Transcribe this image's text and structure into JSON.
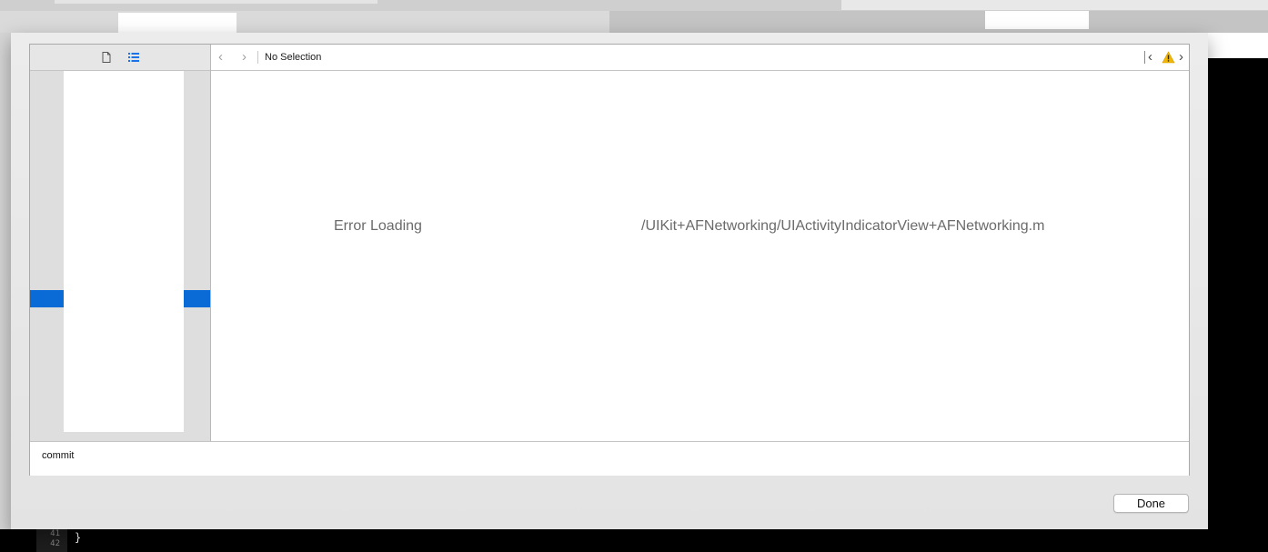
{
  "background": {
    "gutter_lines": [
      "41",
      "42"
    ],
    "code_text": "}"
  },
  "navigator": {
    "icons": [
      "document-icon",
      "list-icon"
    ]
  },
  "jump_bar": {
    "back_glyph": "‹",
    "forward_glyph": "›",
    "selection_label": "No Selection",
    "issue_prev_glyph": "‹",
    "issue_next_glyph": "›"
  },
  "editor": {
    "error_prefix": "Error Loading",
    "error_path": "/UIKit+AFNetworking/UIActivityIndicatorView+AFNetworking.m"
  },
  "commit": {
    "message": "commit"
  },
  "buttons": {
    "done_label": "Done"
  },
  "colors": {
    "selection_blue": "#0b6bd6",
    "warning_yellow": "#f2b705"
  }
}
